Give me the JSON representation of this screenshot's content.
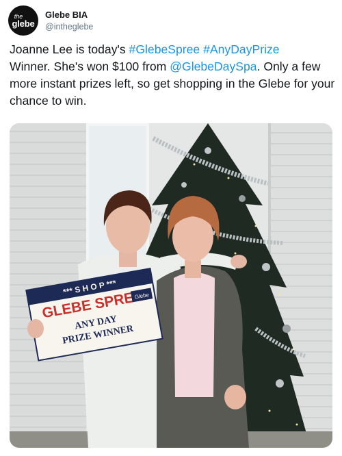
{
  "account": {
    "display_name": "Glebe BIA",
    "handle": "@intheglebe",
    "avatar_text_small": "the",
    "avatar_text_main": "glebe"
  },
  "tweet": {
    "text_1": "Joanne Lee is today's ",
    "hashtag_1": "#GlebeSpree",
    "text_2": " ",
    "hashtag_2": "#AnyDayPrize",
    "text_3": "\n Winner. She's won $100 from ",
    "mention_1": "@GlebeDaySpa",
    "text_4": ". Only a few more instant prizes left, so get shopping in the Glebe for your chance to win."
  },
  "photo": {
    "sign_top": "*** S H O P ***",
    "sign_title": "GLEBE SPREE",
    "sign_line_1": "ANY DAY",
    "sign_line_2": "PRIZE WINNER",
    "sign_logo": "Glebe"
  },
  "colors": {
    "link": "#1b95e0",
    "sign_navy": "#1e2a56",
    "sign_red": "#c9302c",
    "tree_green": "#1f2a22",
    "cardigan": "#5a5a55"
  }
}
